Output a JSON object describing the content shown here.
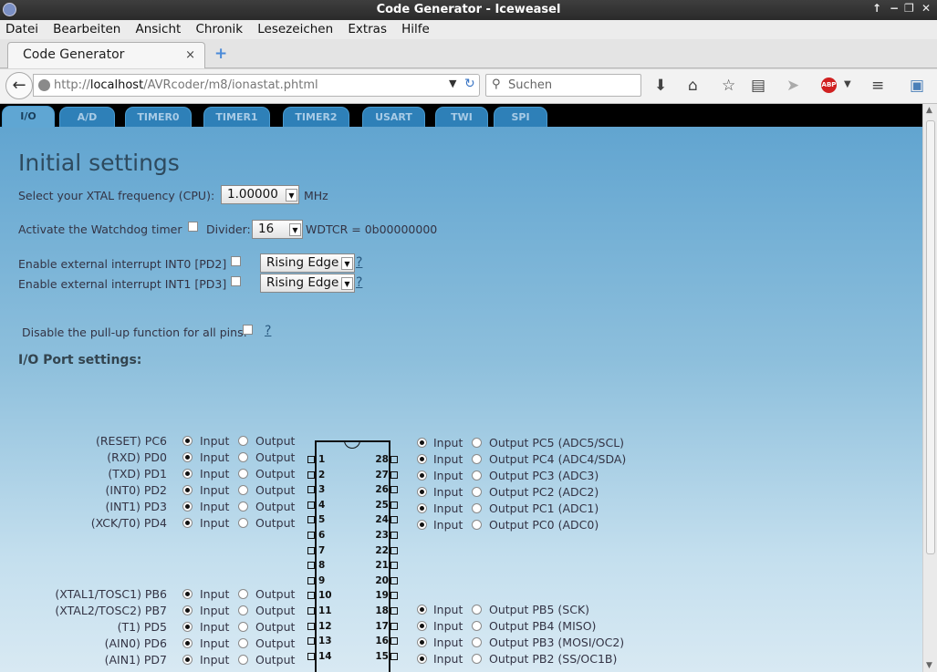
{
  "window": {
    "title": "Code Generator - Iceweasel",
    "controls": [
      "↑",
      "−",
      "❐",
      "✕"
    ]
  },
  "menu": [
    "Datei",
    "Bearbeiten",
    "Ansicht",
    "Chronik",
    "Lesezeichen",
    "Extras",
    "Hilfe"
  ],
  "tab": {
    "label": "Code Generator",
    "close": "×",
    "new": "+"
  },
  "nav": {
    "url_pre": "http://",
    "url_host": "localhost",
    "url_path": "/AVRcoder/m8/ionastat.phtml",
    "search_placeholder": "Suchen"
  },
  "page_tabs": [
    {
      "label": "I/O",
      "active": true
    },
    {
      "label": "A/D"
    },
    {
      "label": "TIMER0"
    },
    {
      "label": "TIMER1"
    },
    {
      "label": "TIMER2"
    },
    {
      "label": "USART"
    },
    {
      "label": "TWI"
    },
    {
      "label": "SPI"
    }
  ],
  "initial": {
    "heading": "Initial settings",
    "xtal_label": "Select your XTAL frequency (CPU):",
    "xtal_value": "1.00000",
    "xtal_unit": "MHz",
    "wd_label": "Activate the Watchdog timer",
    "divider_label": "Divider:",
    "divider_value": "16",
    "wdtcr": "WDTCR = 0b00000000",
    "int0_label": "Enable external interrupt INT0 [PD2]",
    "int0_value": "Rising Edge",
    "int1_label": "Enable external interrupt INT1 [PD3]",
    "int1_value": "Rising Edge",
    "pullup_label": "Disable the pull-up function for all pins:",
    "help": "?"
  },
  "io": {
    "heading": "I/O Port settings:",
    "input": "Input",
    "output": "Output",
    "left": [
      "(RESET) PC6",
      "(RXD) PD0",
      "(TXD) PD1",
      "(INT0) PD2",
      "(INT1) PD3",
      "(XCK/T0) PD4",
      "(XTAL1/TOSC1) PB6",
      "(XTAL2/TOSC2) PB7",
      "(T1) PD5",
      "(AIN0) PD6",
      "(AIN1) PD7"
    ],
    "right_top": [
      "Output PC5 (ADC5/SCL)",
      "Output PC4 (ADC4/SDA)",
      "Output PC3 (ADC3)",
      "Output PC2 (ADC2)",
      "Output PC1 (ADC1)",
      "Output PC0 (ADC0)"
    ],
    "right_bottom": [
      "Output PB5 (SCK)",
      "Output PB4 (MISO)",
      "Output PB3 (MOSI/OC2)",
      "Output PB2 (SS/OC1B)"
    ],
    "pins_left": [
      "1",
      "2",
      "3",
      "4",
      "5",
      "6",
      "7",
      "8",
      "9",
      "10",
      "11",
      "12",
      "13",
      "14"
    ],
    "pins_right": [
      "28",
      "27",
      "26",
      "25",
      "24",
      "23",
      "22",
      "21",
      "20",
      "19",
      "18",
      "17",
      "16",
      "15"
    ]
  }
}
